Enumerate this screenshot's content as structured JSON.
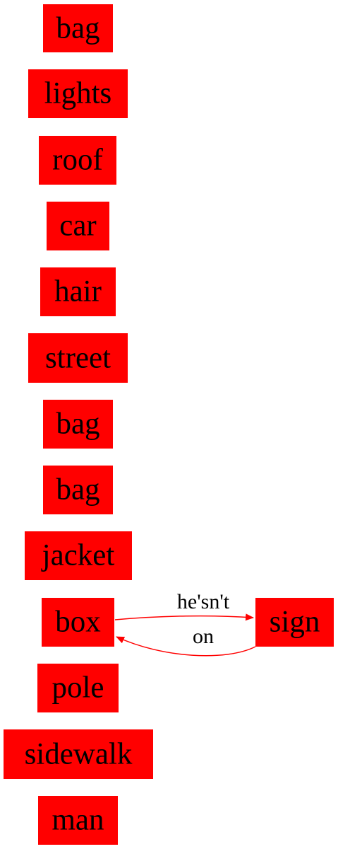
{
  "graph": {
    "node_color": "#ff0000",
    "text_color": "#000000",
    "edge_color": "#ff0000",
    "nodes": [
      {
        "id": "bag1",
        "label": "bag"
      },
      {
        "id": "lights",
        "label": "lights"
      },
      {
        "id": "roof",
        "label": "roof"
      },
      {
        "id": "car",
        "label": "car"
      },
      {
        "id": "hair",
        "label": "hair"
      },
      {
        "id": "street",
        "label": "street"
      },
      {
        "id": "bag2",
        "label": "bag"
      },
      {
        "id": "bag3",
        "label": "bag"
      },
      {
        "id": "jacket",
        "label": "jacket"
      },
      {
        "id": "box",
        "label": "box"
      },
      {
        "id": "sign",
        "label": "sign"
      },
      {
        "id": "pole",
        "label": "pole"
      },
      {
        "id": "sidewalk",
        "label": "sidewalk"
      },
      {
        "id": "man",
        "label": "man"
      }
    ],
    "edges": [
      {
        "from": "box",
        "to": "sign",
        "label": "he'sn't"
      },
      {
        "from": "sign",
        "to": "box",
        "label": "on"
      }
    ]
  }
}
